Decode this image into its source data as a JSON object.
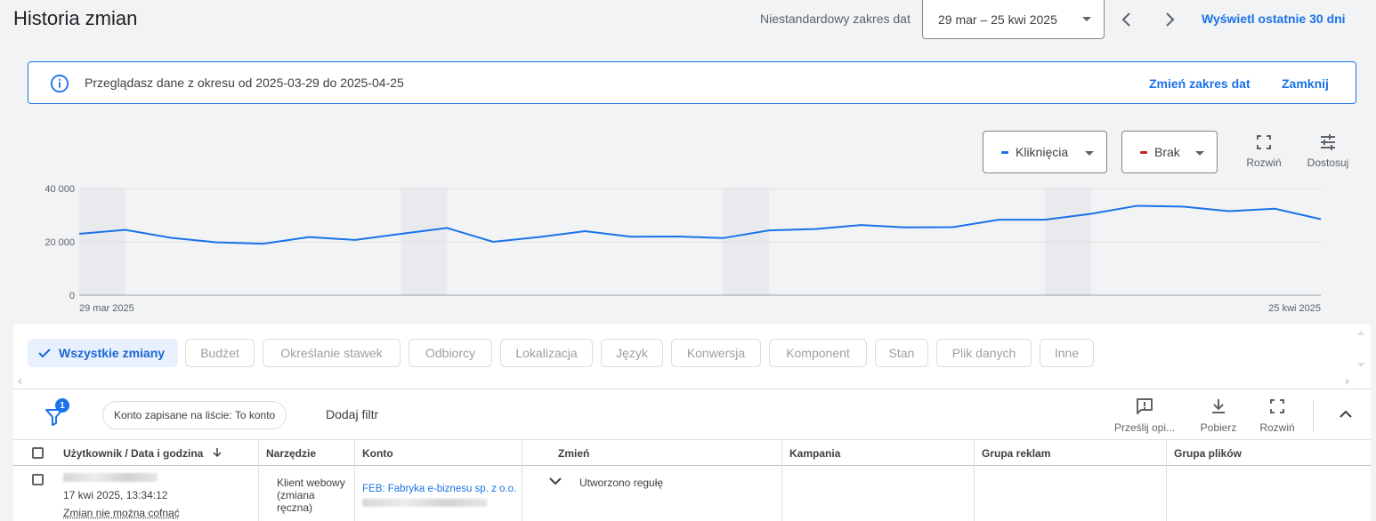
{
  "header": {
    "title": "Historia zmian",
    "range_label": "Niestandardowy zakres dat",
    "date_range": "29 mar – 25 kwi 2025",
    "last_30_label": "Wyświetl ostatnie 30 dni"
  },
  "banner": {
    "message": "Przeglądasz dane z okresu od 2025-03-29 do 2025-04-25",
    "change_range_label": "Zmień zakres dat",
    "close_label": "Zamknij"
  },
  "chart_controls": {
    "metric1": "Kliknięcia",
    "metric1_color": "#1a73e8",
    "metric2": "Brak",
    "metric2_color": "#c5221f",
    "expand_label": "Rozwiń",
    "customize_label": "Dostosuj"
  },
  "chart_data": {
    "type": "line",
    "series": [
      {
        "name": "Kliknięcia",
        "color": "#1a73e8",
        "values": [
          23000,
          24500,
          21500,
          19800,
          19300,
          21800,
          20700,
          23000,
          25200,
          20000,
          21800,
          24000,
          21900,
          22000,
          21400,
          24300,
          24800,
          26300,
          25400,
          25500,
          28300,
          28300,
          30500,
          33500,
          33200,
          31500,
          32400,
          28500
        ]
      }
    ],
    "x_start_label": "29 mar 2025",
    "x_end_label": "25 kwi 2025",
    "y_ticks": [
      "0",
      "20 000",
      "40 000"
    ],
    "ylim": [
      0,
      40000
    ],
    "grid": true,
    "weekend_shading": true
  },
  "filter_chips": [
    {
      "label": "Wszystkie zmiany",
      "active": true
    },
    {
      "label": "Budżet",
      "active": false
    },
    {
      "label": "Określanie stawek",
      "active": false
    },
    {
      "label": "Odbiorcy",
      "active": false
    },
    {
      "label": "Lokalizacja",
      "active": false
    },
    {
      "label": "Język",
      "active": false
    },
    {
      "label": "Konwersja",
      "active": false
    },
    {
      "label": "Komponent",
      "active": false
    },
    {
      "label": "Stan",
      "active": false
    },
    {
      "label": "Plik danych",
      "active": false
    },
    {
      "label": "Inne",
      "active": false
    }
  ],
  "table_toolbar": {
    "filter_count": "1",
    "saved_filter": "Konto zapisane na liście: To konto",
    "add_filter": "Dodaj filtr",
    "feedback_label": "Prześlij opi...",
    "download_label": "Pobierz",
    "expand_label": "Rozwiń"
  },
  "table": {
    "columns": [
      "Użytkownik / Data i godzina",
      "Narzędzie",
      "Konto",
      "Zmień",
      "Kampania",
      "Grupa reklam",
      "Grupa plików"
    ],
    "rows": [
      {
        "datetime": "17 kwi 2025, 13:34:12",
        "undo_note": "Zmian nie można cofnąć",
        "tool": "Klient webowy (zmiana ręczna)",
        "account": "FEB: Fabryka e-biznesu sp. z o.o.",
        "change": "Utworzono regułę",
        "campaign": "",
        "ad_group": "",
        "asset_group": ""
      }
    ]
  }
}
